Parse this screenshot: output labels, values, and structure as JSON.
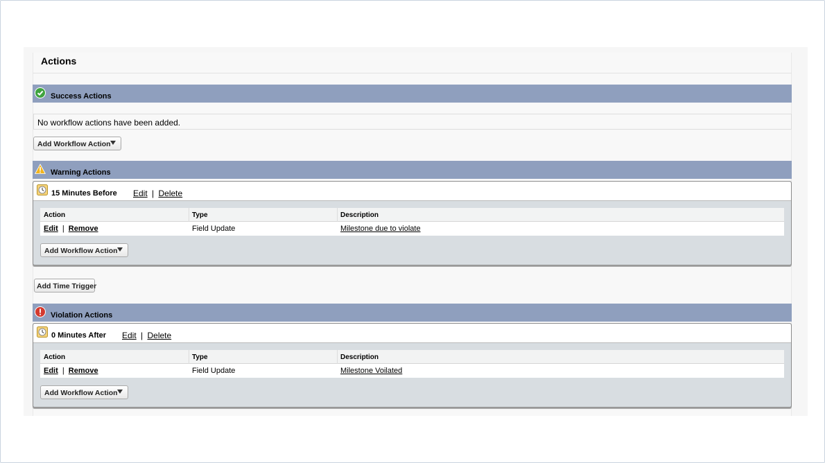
{
  "page": {
    "title": "Actions"
  },
  "success": {
    "label": "Success Actions",
    "icon": "check-circle-icon",
    "color": "#4caf50",
    "empty_message": "No workflow actions have been added.",
    "add_button": "Add Workflow Action"
  },
  "warning": {
    "label": "Warning Actions",
    "icon": "warning-triangle-icon",
    "color": "#f5b400",
    "trigger": {
      "name": "15 Minutes Before",
      "edit": "Edit",
      "delete": "Delete",
      "columns": [
        "Action",
        "Type",
        "Description"
      ],
      "rows": [
        {
          "edit": "Edit",
          "remove": "Remove",
          "type": "Field Update",
          "description": "Milestone due to violate"
        }
      ],
      "add_button": "Add Workflow Action"
    },
    "add_trigger_button": "Add Time Trigger"
  },
  "violation": {
    "label": "Violation Actions",
    "icon": "error-circle-icon",
    "color": "#d32f2f",
    "trigger": {
      "name": "0 Minutes After",
      "edit": "Edit",
      "delete": "Delete",
      "columns": [
        "Action",
        "Type",
        "Description"
      ],
      "rows": [
        {
          "edit": "Edit",
          "remove": "Remove",
          "type": "Field Update",
          "description": "Milestone Voilated"
        }
      ],
      "add_button": "Add Workflow Action"
    }
  },
  "separator": "|",
  "band_color": "#8f9fbe"
}
